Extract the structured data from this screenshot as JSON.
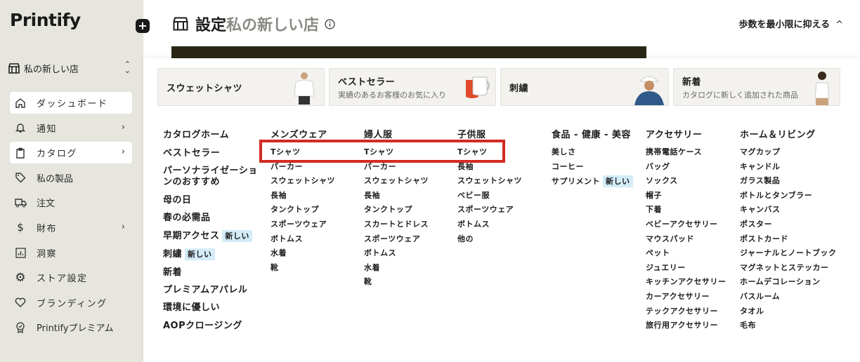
{
  "sidebar": {
    "logo": "Printify",
    "add_label": "+",
    "store_name": "私の新しい店",
    "items": [
      {
        "label": "ダッシュボード",
        "icon": "home-icon",
        "active": true
      },
      {
        "label": "通知",
        "icon": "bell-icon",
        "arrow": true
      },
      {
        "label": "カタログ",
        "icon": "clipboard-icon",
        "arrow": true,
        "active": true
      },
      {
        "label": "私の製品",
        "icon": "tag-icon"
      },
      {
        "label": "注文",
        "icon": "truck-icon"
      },
      {
        "label": "財布",
        "icon": "dollar-icon",
        "arrow": true
      },
      {
        "label": "洞察",
        "icon": "chart-icon"
      },
      {
        "label": "ストア設定",
        "icon": "gear-icon"
      },
      {
        "label": "ブランディング",
        "icon": "heart-icon"
      },
      {
        "label": "Printifyプレミアム",
        "icon": "premium-icon"
      }
    ]
  },
  "header": {
    "title": "設定",
    "store": "私の新しい店",
    "minimize_label": "歩数を最小限に抑える",
    "caret": "^"
  },
  "promos": [
    {
      "title": "スウェットシャツ",
      "subtitle": ""
    },
    {
      "title": "ベストセラー",
      "subtitle": "実績のあるお客様のお気に入り"
    },
    {
      "title": "刺繍",
      "subtitle": ""
    },
    {
      "title": "新着",
      "subtitle": "カタログに新しく追加された商品"
    }
  ],
  "badge_new": "新しい",
  "columns": {
    "catalog": {
      "head": "カタログホーム",
      "items": [
        "ベストセラー",
        "パーソナライゼーションのおすすめ",
        "母の日",
        "春の必需品",
        "早期アクセス",
        "刺繍",
        "新着",
        "プレミアムアパレル",
        "環境に優しい",
        "AOPクロージング"
      ]
    },
    "mens": {
      "head": "メンズウェア",
      "items": [
        "Tシャツ",
        "パーカー",
        "スウェットシャツ",
        "長袖",
        "タンクトップ",
        "スポーツウェア",
        "ボトムス",
        "水着",
        "靴"
      ]
    },
    "womens": {
      "head": "婦人服",
      "items": [
        "Tシャツ",
        "パーカー",
        "スウェットシャツ",
        "長袖",
        "タンクトップ",
        "スカートとドレス",
        "スポーツウェア",
        "ボトムス",
        "水着",
        "靴"
      ]
    },
    "kids": {
      "head": "子供服",
      "items": [
        "Tシャツ",
        "長袖",
        "スウェットシャツ",
        "ベビー服",
        "スポーツウェア",
        "ボトムス",
        "他の"
      ]
    },
    "food": {
      "head": "食品 - 健康 - 美容",
      "items": [
        "美しさ",
        "コーヒー",
        "サプリメント"
      ]
    },
    "accessories": {
      "head": "アクセサリー",
      "items": [
        "携帯電話ケース",
        "バッグ",
        "ソックス",
        "帽子",
        "下着",
        "ベビーアクセサリー",
        "マウスパッド",
        "ペット",
        "ジュエリー",
        "キッチンアクセサリー",
        "カーアクセサリー",
        "テックアクセサリー",
        "旅行用アクセサリー"
      ]
    },
    "home": {
      "head": "ホーム＆リビング",
      "items": [
        "マグカップ",
        "キャンドル",
        "ガラス製品",
        "ボトルとタンブラー",
        "キャンバス",
        "ポスター",
        "ポストカード",
        "ジャーナルとノートブック",
        "マグネットとステッカー",
        "ホームデコレーション",
        "バスルーム",
        "タオル",
        "毛布"
      ]
    }
  },
  "colors": {
    "sidebar_bg": "#e6e5de",
    "badge_bg": "#d3ecf8",
    "highlight_red": "#d22b22",
    "dark_bar": "#2b2715"
  }
}
